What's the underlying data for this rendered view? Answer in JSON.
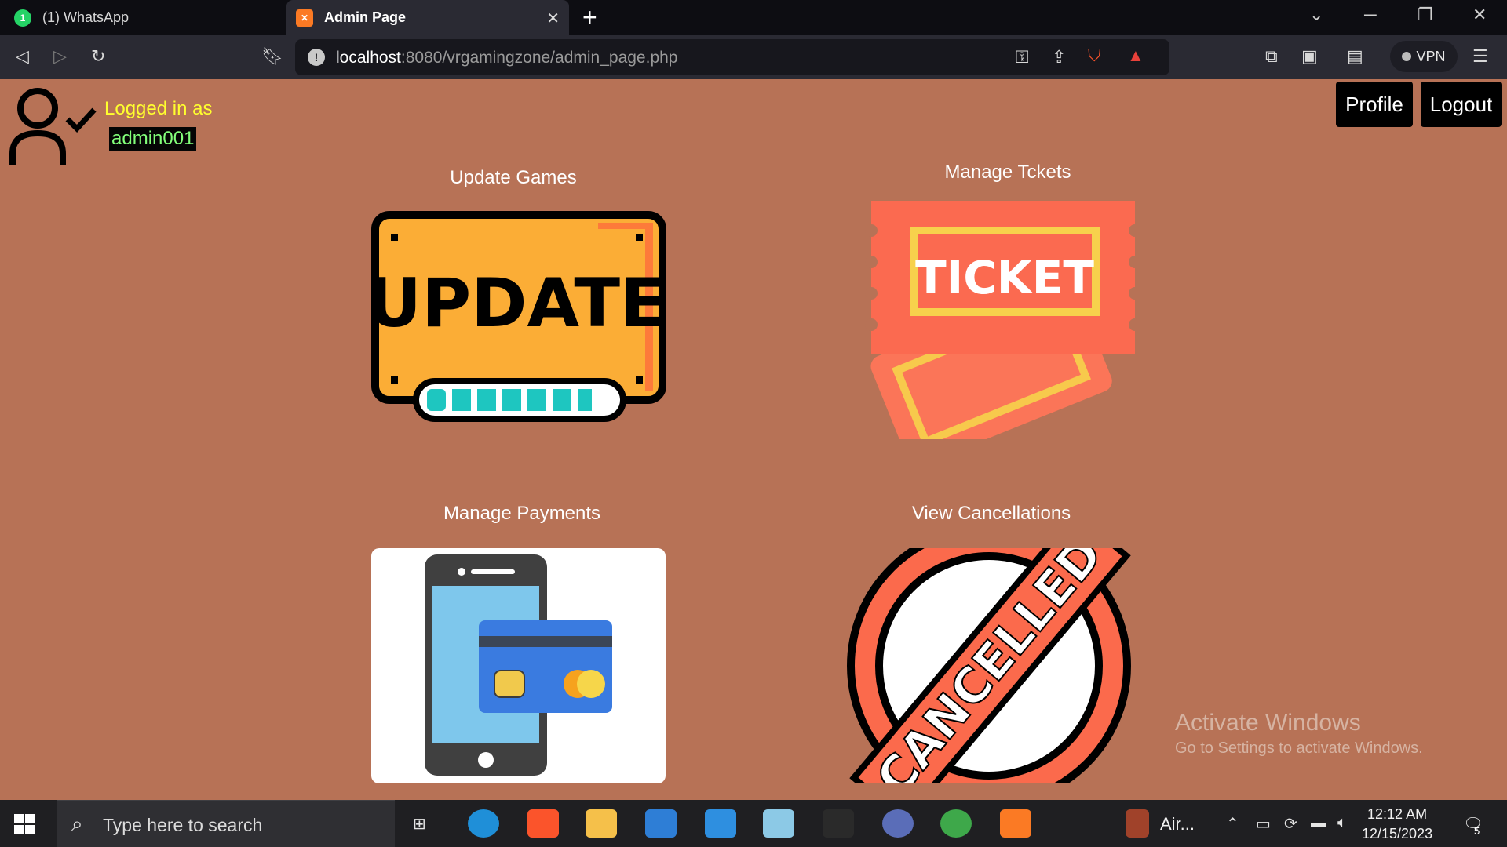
{
  "browser": {
    "tabs": [
      {
        "label": "(1) WhatsApp",
        "active": false,
        "icon": "whatsapp-icon",
        "badge": "1"
      },
      {
        "label": "Admin Page",
        "active": true,
        "icon": "xampp-icon"
      }
    ],
    "url_host": "localhost",
    "url_rest": ":8080/vrgamingzone/admin_page.php",
    "vpn_label": "VPN"
  },
  "page": {
    "logged_in_label": "Logged in as",
    "username": "admin001",
    "profile_label": "Profile",
    "logout_label": "Logout",
    "cards": [
      {
        "title": "Update Games",
        "image_text": "UPDATE"
      },
      {
        "title": "Manage Tckets",
        "image_text": "TICKET"
      },
      {
        "title": "Manage Payments"
      },
      {
        "title": "View Cancellations",
        "image_text": "CANCELLED"
      }
    ]
  },
  "watermark": {
    "line1": "Activate Windows",
    "line2": "Go to Settings to activate Windows."
  },
  "taskbar": {
    "search_placeholder": "Type here to search",
    "running_app_label": "Air...",
    "time": "12:12 AM",
    "date": "12/15/2023",
    "notification_count": "5"
  },
  "colors": {
    "page_bg": "#b77256",
    "logged_label": "#ffff2e",
    "username": "#83ff7a"
  }
}
